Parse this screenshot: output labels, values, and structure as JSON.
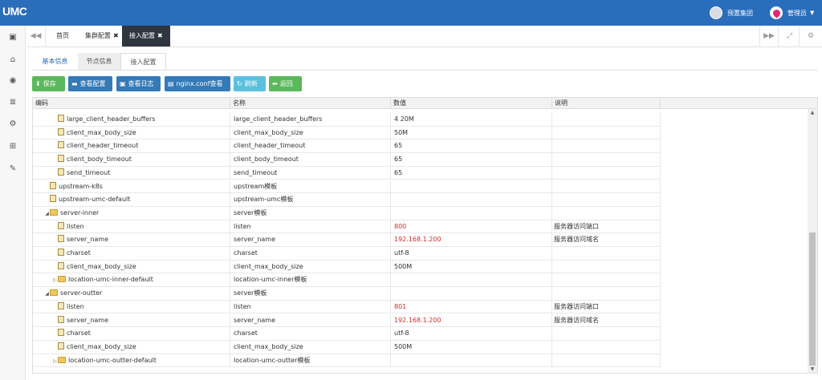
{
  "header": {
    "logo": "UMC",
    "group": "预置集团",
    "user": "管理员"
  },
  "tabbar": {
    "tabs": [
      {
        "label": "首页"
      },
      {
        "label": "集群配置"
      },
      {
        "label": "接入配置"
      }
    ],
    "close_glyph": "✖"
  },
  "subtabs": [
    "基本信息",
    "节点信息",
    "接入配置"
  ],
  "toolbar": {
    "save": "保存",
    "view_config": "查看配置",
    "view_log": "查看日志",
    "nginx_view": "nginx.conf查看",
    "refresh": "刷新",
    "back": "返回"
  },
  "grid": {
    "columns": [
      "编码",
      "名称",
      "数值",
      "说明"
    ],
    "rows": [
      {
        "code": "large_client_header_buffers",
        "name": "large_client_header_buffers",
        "value": "4 20M",
        "desc": "",
        "level": 2,
        "kind": "file"
      },
      {
        "code": "client_max_body_size",
        "name": "client_max_body_size",
        "value": "50M",
        "desc": "",
        "level": 2,
        "kind": "file"
      },
      {
        "code": "client_header_timeout",
        "name": "client_header_timeout",
        "value": "65",
        "desc": "",
        "level": 2,
        "kind": "file"
      },
      {
        "code": "client_body_timeout",
        "name": "client_body_timeout",
        "value": "65",
        "desc": "",
        "level": 2,
        "kind": "file"
      },
      {
        "code": "send_timeout",
        "name": "send_timeout",
        "value": "65",
        "desc": "",
        "level": 2,
        "kind": "file"
      },
      {
        "code": "upstream-k8s",
        "name": "upstream模板",
        "value": "",
        "desc": "",
        "level": 1,
        "kind": "file"
      },
      {
        "code": "upstream-umc-default",
        "name": "upstream-umc模板",
        "value": "",
        "desc": "",
        "level": 1,
        "kind": "file"
      },
      {
        "code": "server-inner",
        "name": "server模板",
        "value": "",
        "desc": "",
        "level": 1,
        "kind": "folder",
        "expanded": true
      },
      {
        "code": "listen",
        "name": "listen",
        "value": "800",
        "desc": "服务器访问端口",
        "level": 2,
        "kind": "file",
        "red": true
      },
      {
        "code": "server_name",
        "name": "server_name",
        "value": "192.168.1.200",
        "desc": "服务器访问域名",
        "level": 2,
        "kind": "file",
        "red": true
      },
      {
        "code": "charset",
        "name": "charset",
        "value": "utf-8",
        "desc": "",
        "level": 2,
        "kind": "file"
      },
      {
        "code": "client_max_body_size",
        "name": "client_max_body_size",
        "value": "500M",
        "desc": "",
        "level": 2,
        "kind": "file"
      },
      {
        "code": "location-umc-inner-default",
        "name": "location-umc-inner模板",
        "value": "",
        "desc": "",
        "level": 2,
        "kind": "folder",
        "expanded": false
      },
      {
        "code": "server-outter",
        "name": "server模板",
        "value": "",
        "desc": "",
        "level": 1,
        "kind": "folder",
        "expanded": true
      },
      {
        "code": "listen",
        "name": "listen",
        "value": "801",
        "desc": "服务器访问端口",
        "level": 2,
        "kind": "file",
        "red": true
      },
      {
        "code": "server_name",
        "name": "server_name",
        "value": "192.168.1.200",
        "desc": "服务器访问域名",
        "level": 2,
        "kind": "file",
        "red": true
      },
      {
        "code": "charset",
        "name": "charset",
        "value": "utf-8",
        "desc": "",
        "level": 2,
        "kind": "file"
      },
      {
        "code": "client_max_body_size",
        "name": "client_max_body_size",
        "value": "500M",
        "desc": "",
        "level": 2,
        "kind": "file"
      },
      {
        "code": "location-umc-outter-default",
        "name": "location-umc-outter模板",
        "value": "",
        "desc": "",
        "level": 2,
        "kind": "folder",
        "expanded": false
      }
    ]
  },
  "icons": {
    "sidebar": [
      "id-card-icon",
      "bank-icon",
      "eye-icon",
      "list-icon",
      "gear-icon",
      "sitemap-icon",
      "wrench-icon"
    ]
  },
  "colors": {
    "header": "#2a6ebb",
    "value_highlight": "#c9302c",
    "save_button": "#5cb85c",
    "primary_button": "#337ab7"
  }
}
